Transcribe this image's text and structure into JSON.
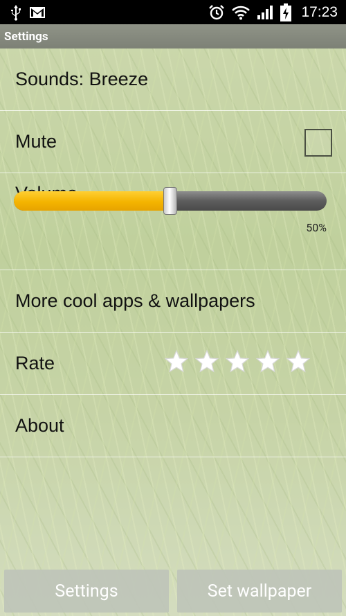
{
  "statusbar": {
    "time": "17:23",
    "left_icons": [
      "usb-icon",
      "gmail-icon"
    ],
    "right_icons": [
      "alarm-icon",
      "wifi-icon",
      "signal-icon",
      "battery-charging-icon"
    ]
  },
  "title": "Settings",
  "settings": {
    "sounds_label": "Sounds: Breeze",
    "mute_label": "Mute",
    "mute_checked": false,
    "volume_label": "Volume",
    "volume_percent_label": "50%",
    "volume_level": 0.5,
    "more_apps_label": "More cool apps & wallpapers",
    "rate_label": "Rate",
    "rate_stars": 5,
    "about_label": "About"
  },
  "buttons": {
    "settings_label": "Settings",
    "set_wallpaper_label": "Set wallpaper"
  },
  "colors": {
    "slider_fill": "#f4b400",
    "statusbar_bg": "#000000",
    "titlebar_bg": "#858a7e"
  }
}
